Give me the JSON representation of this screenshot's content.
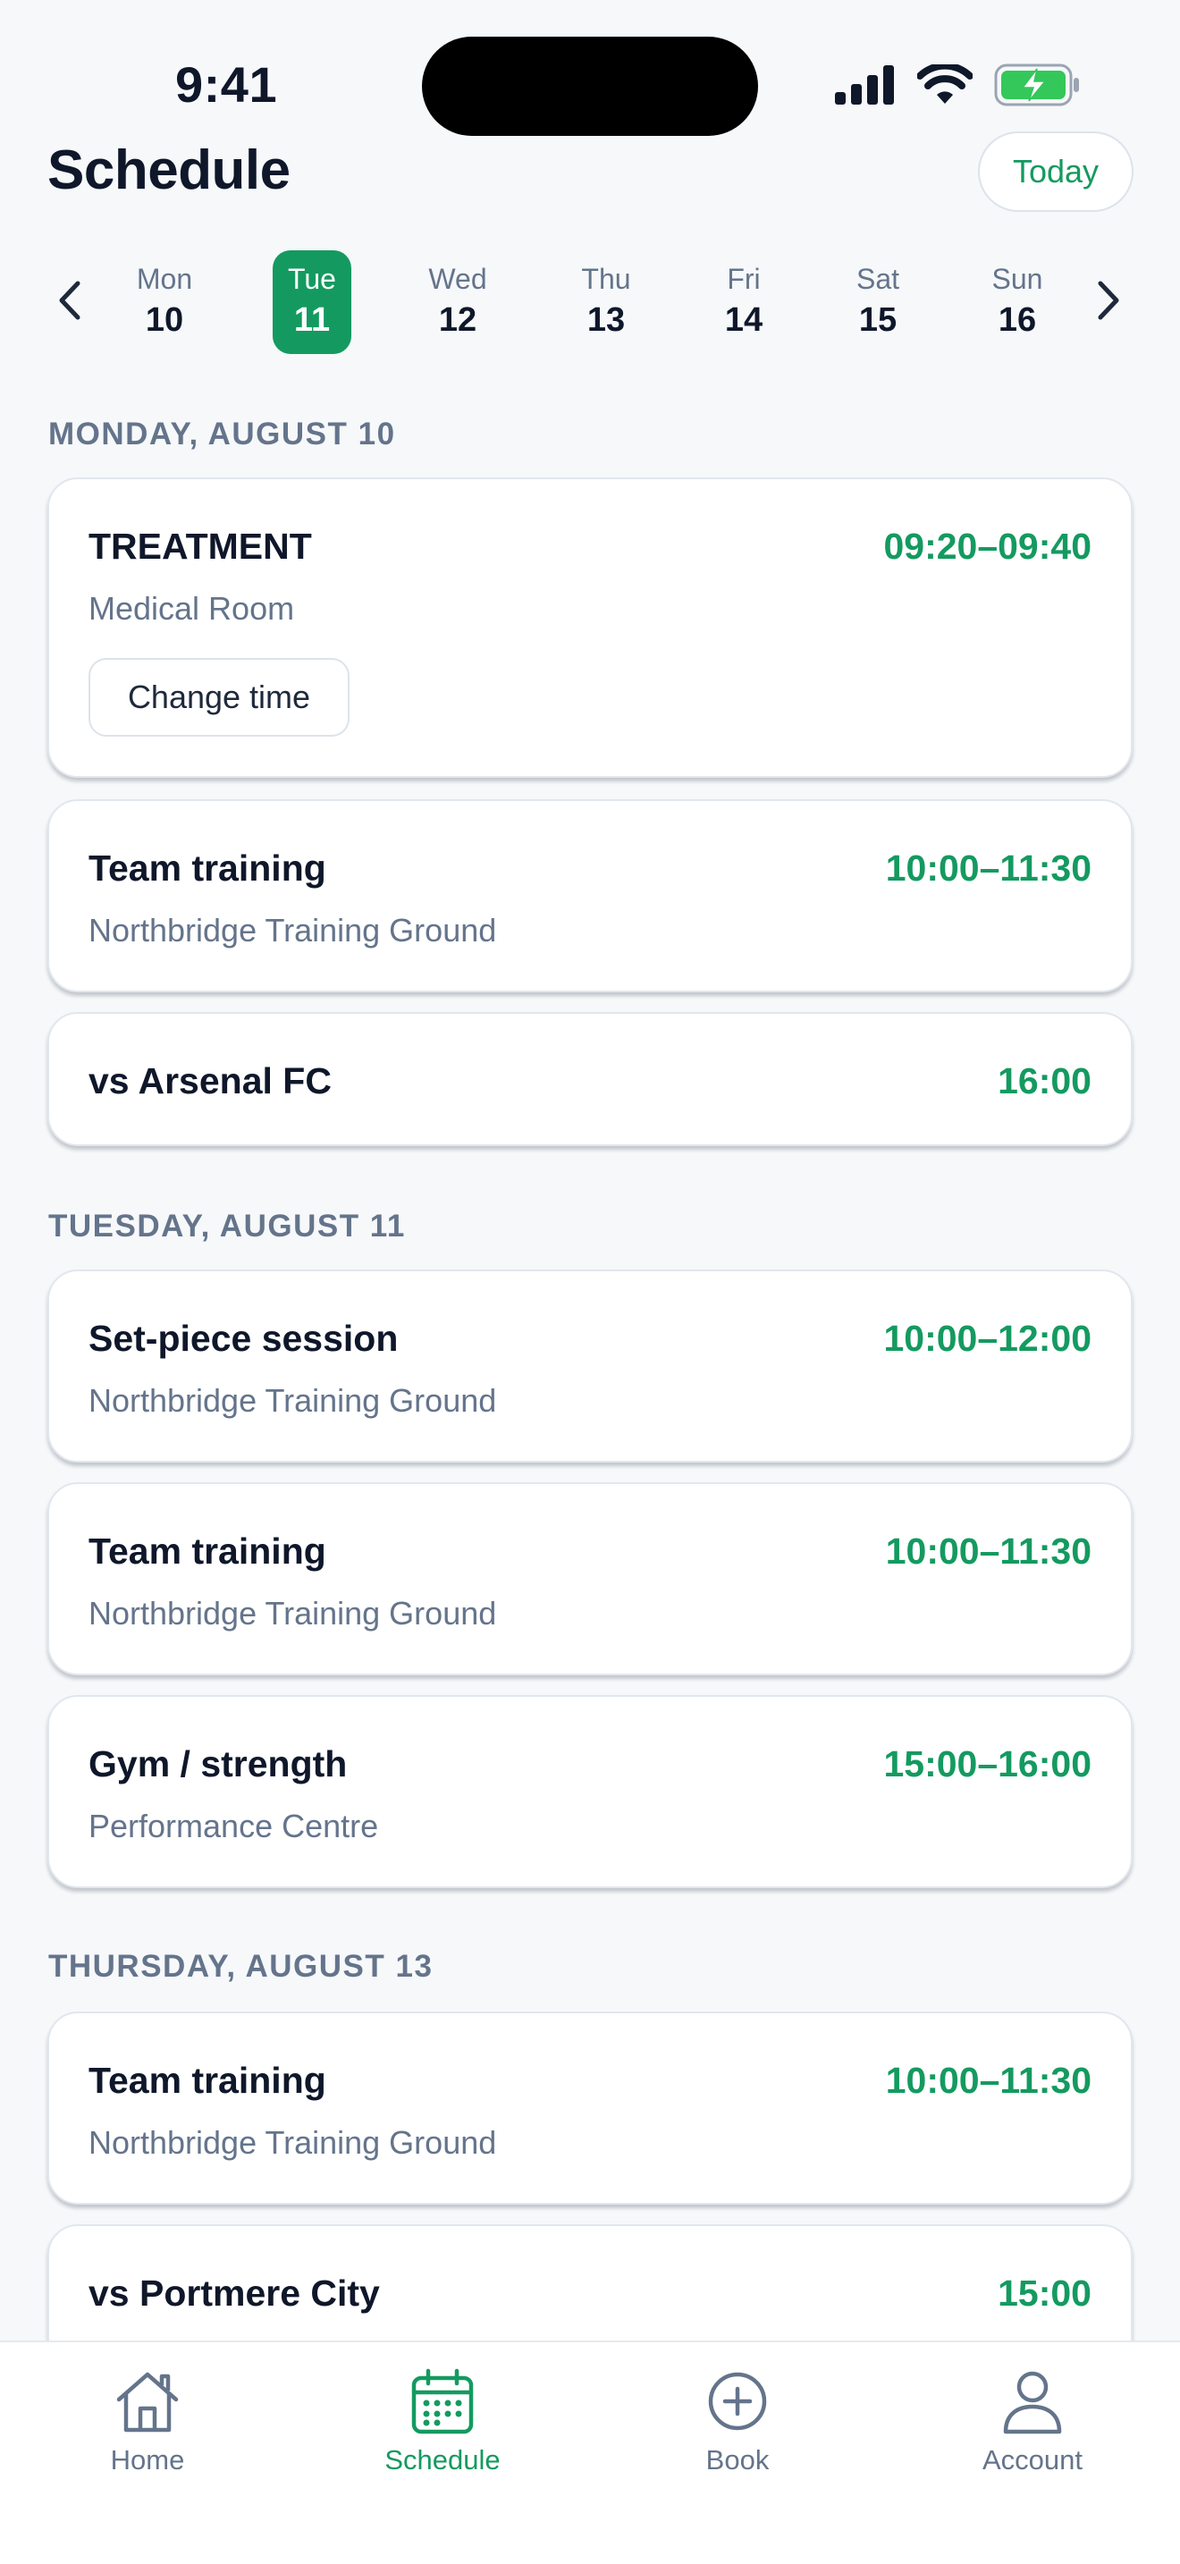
{
  "status_bar": {
    "time": "9:41"
  },
  "header": {
    "title": "Schedule",
    "today_label": "Today"
  },
  "week": {
    "days": [
      {
        "dow": "Mon",
        "num": "10",
        "selected": false
      },
      {
        "dow": "Tue",
        "num": "11",
        "selected": true
      },
      {
        "dow": "Wed",
        "num": "12",
        "selected": false
      },
      {
        "dow": "Thu",
        "num": "13",
        "selected": false
      },
      {
        "dow": "Fri",
        "num": "14",
        "selected": false
      },
      {
        "dow": "Sat",
        "num": "15",
        "selected": false
      },
      {
        "dow": "Sun",
        "num": "16",
        "selected": false
      }
    ]
  },
  "sections": [
    {
      "heading": "MONDAY, AUGUST 10",
      "events": [
        {
          "title": "TREATMENT",
          "time": "09:20–09:40",
          "location": "Medical Room",
          "action": "Change time"
        },
        {
          "title": "Team training",
          "time": "10:00–11:30",
          "location": "Northbridge Training Ground"
        },
        {
          "title": "vs Arsenal FC",
          "time": "16:00"
        }
      ]
    },
    {
      "heading": "TUESDAY, AUGUST 11",
      "events": [
        {
          "title": "Set-piece session",
          "time": "10:00–12:00",
          "location": "Northbridge Training Ground"
        },
        {
          "title": "Team training",
          "time": "10:00–11:30",
          "location": "Northbridge Training Ground"
        },
        {
          "title": "Gym / strength",
          "time": "15:00–16:00",
          "location": "Performance Centre"
        }
      ]
    },
    {
      "heading": "THURSDAY, AUGUST 13",
      "events": [
        {
          "title": "Team training",
          "time": "10:00–11:30",
          "location": "Northbridge Training Ground"
        },
        {
          "title": "vs Portmere City",
          "time": "15:00"
        }
      ]
    }
  ],
  "tabs": [
    {
      "label": "Home",
      "icon": "home-icon",
      "active": false
    },
    {
      "label": "Schedule",
      "icon": "calendar-icon",
      "active": true
    },
    {
      "label": "Book",
      "icon": "plus-circle-icon",
      "active": false
    },
    {
      "label": "Account",
      "icon": "user-icon",
      "active": false
    }
  ],
  "colors": {
    "accent": "#149a60",
    "muted": "#64748b",
    "text": "#0f172a",
    "battery": "#34c759"
  }
}
